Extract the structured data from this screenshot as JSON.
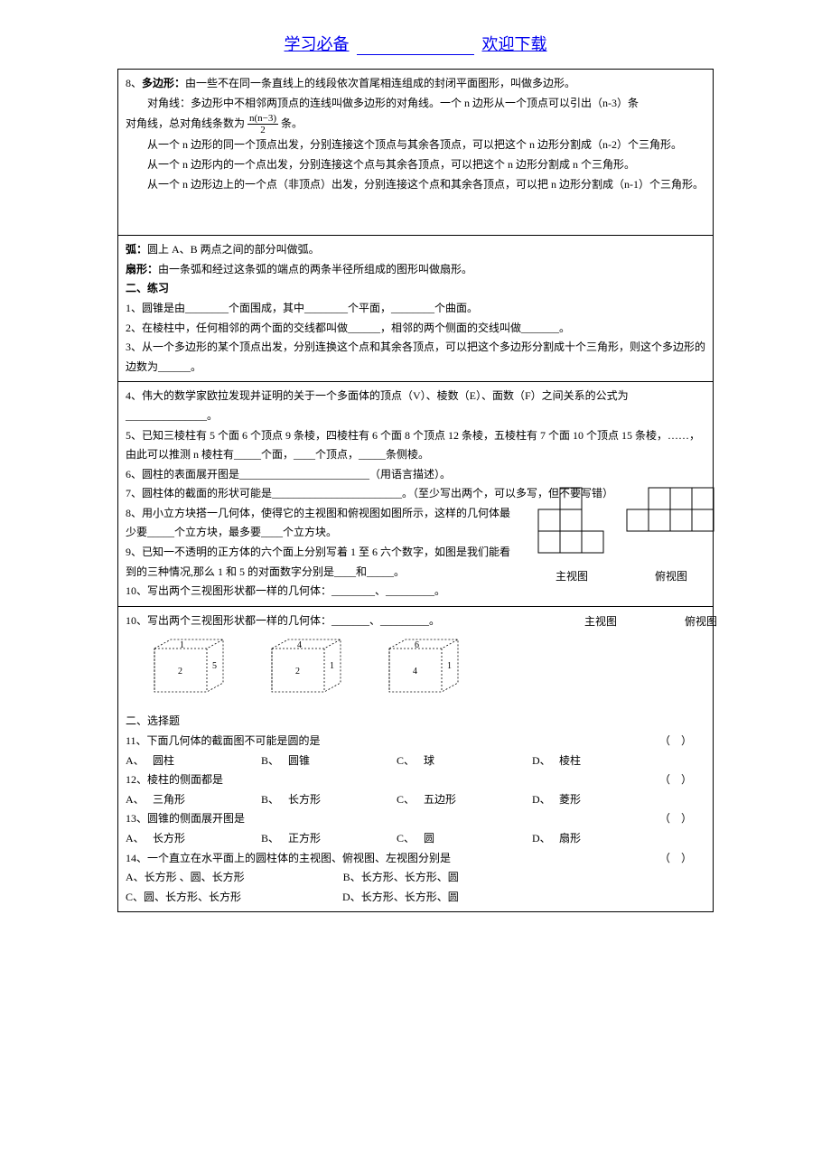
{
  "header": {
    "left": "学习必备",
    "right": "欢迎下载"
  },
  "sec1": {
    "l1a": "8、",
    "l1b": "多边形：",
    "l1c": "由一些不在同一条直线上的线段依次首尾相连组成的封闭平面图形，叫做多边形。",
    "l2": "对角线：多边形中不相邻两顶点的连线叫做多边形的对角线。一个 n 边形从一个顶点可以引出（n-3）条",
    "l3a": "对角线，总对角线条数为",
    "frac_num": "n(n−3)",
    "frac_den": "2",
    "l3b": "条。",
    "l4": "从一个 n 边形的同一个顶点出发，分别连接这个顶点与其余各顶点，可以把这个 n 边形分割成（n-2）个三角形。",
    "l5": "从一个 n 边形内的一个点出发，分别连接这个点与其余各顶点，可以把这个 n 边形分割成 n 个三角形。",
    "l6": "从一个 n 边形边上的一个点（非顶点）出发，分别连接这个点和其余各顶点，可以把 n 边形分割成（n-1）个三角形。"
  },
  "sec2": {
    "arc_label": "弧：",
    "arc": "圆上 A、B 两点之间的部分叫做弧。",
    "fan_label": "扇形：",
    "fan": "由一条弧和经过这条弧的端点的两条半径所组成的图形叫做扇形。",
    "ex_title": "二、练习",
    "q1": "1、圆锥是由________个面围成，其中________个平面，________个曲面。",
    "q2": "2、在棱柱中，任何相邻的两个面的交线都叫做______，相邻的两个侧面的交线叫做_______。",
    "q3": "3、从一个多边形的某个顶点出发，分别连换这个点和其余各顶点，可以把这个多边形分割成十个三角形，则这个多边形的边数为______。"
  },
  "sec3": {
    "q4": "4、伟大的数学家欧拉发现并证明的关于一个多面体的顶点（V）、棱数（E）、面数（F）之间关系的公式为_______________。",
    "q5": "5、已知三棱柱有 5 个面 6 个顶点 9 条棱，四棱柱有 6 个面 8 个顶点 12 条棱，五棱柱有 7 个面 10 个顶点 15 条棱，……，由此可以推测 n 棱柱有_____个面，____个顶点，_____条侧棱。",
    "q6": "6、圆柱的表面展开图是________________________（用语言描述）。",
    "q7": "7、圆柱体的截面的形状可能是________________________。（至少写出两个，可以多写，但不要写错）",
    "q8": "8、用小立方块搭一几何体，使得它的主视图和俯视图如图所示，这样的几何体最少要_____个立方块，最多要____个立方块。",
    "q9": "9、已知一不透明的正方体的六个面上分别写着 1 至 6 六个数字，如图是我们能看到的三种情况,那么 1 和 5 的对面数字分别是____和_____。",
    "q10": "10、写出两个三视图形状都一样的几何体：________、_________。",
    "fig1_label": "主视图",
    "fig2_label": "俯视图"
  },
  "sec4": {
    "q10": "10、写出两个三视图形状都一样的几何体：_______、_________。",
    "fig1_label": "主视图",
    "fig2_label": "俯视图",
    "cube1": {
      "top": "1",
      "front": "2",
      "side": "5"
    },
    "cube2": {
      "top": "4",
      "front": "2",
      "side": "1"
    },
    "cube3": {
      "top": "6",
      "front": "4",
      "side": "1"
    },
    "choice_title": "二、选择题",
    "q11": "11、下面几何体的截面图不可能是圆的是",
    "q11a": "圆柱",
    "q11b": "圆锥",
    "q11c": "球",
    "q11d": "棱柱",
    "q12": "12、棱柱的侧面都是",
    "q12a": "三角形",
    "q12b": "长方形",
    "q12c": "五边形",
    "q12d": "菱形",
    "q13": "13、圆锥的侧面展开图是",
    "q13a": "长方形",
    "q13b": "正方形",
    "q13c": "圆",
    "q13d": "扇形",
    "q14": "14、一个直立在水平面上的圆柱体的主视图、俯视图、左视图分别是",
    "q14a": "长方形 、圆、长方形",
    "q14b": "长方形、长方形、圆",
    "q14c": "圆、长方形、长方形",
    "q14d": "长方形、长方形、圆",
    "labA": "A、",
    "labB": "B、",
    "labC": "C、",
    "labD": "D、",
    "paren_l": "（",
    "paren_r": "）"
  }
}
